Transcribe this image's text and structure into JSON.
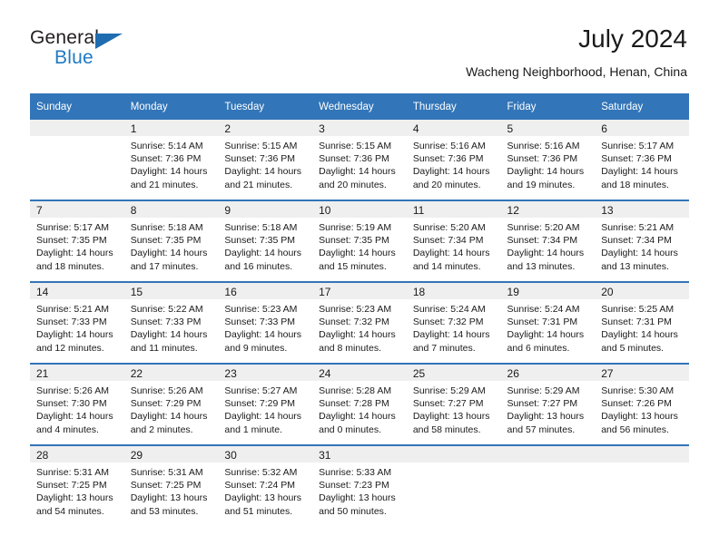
{
  "brand": {
    "name_primary": "General",
    "name_secondary": "Blue",
    "logo_icon": "triangle-logo-icon",
    "color_primary": "#231f20",
    "color_secondary": "#1f7ac4",
    "color_triangle": "#1f6cb0"
  },
  "header": {
    "title": "July 2024",
    "subtitle": "Wacheng Neighborhood, Henan, China"
  },
  "theme": {
    "header_bar_bg": "#3275b8",
    "header_bar_text": "#ffffff",
    "daynum_band_bg": "#efefef",
    "week_divider": "#3275b8",
    "body_text": "#1a1a1a"
  },
  "weekday_headers": [
    "Sunday",
    "Monday",
    "Tuesday",
    "Wednesday",
    "Thursday",
    "Friday",
    "Saturday"
  ],
  "weeks": [
    [
      {
        "day": "",
        "lines": []
      },
      {
        "day": "1",
        "lines": [
          "Sunrise: 5:14 AM",
          "Sunset: 7:36 PM",
          "Daylight: 14 hours",
          "and 21 minutes."
        ]
      },
      {
        "day": "2",
        "lines": [
          "Sunrise: 5:15 AM",
          "Sunset: 7:36 PM",
          "Daylight: 14 hours",
          "and 21 minutes."
        ]
      },
      {
        "day": "3",
        "lines": [
          "Sunrise: 5:15 AM",
          "Sunset: 7:36 PM",
          "Daylight: 14 hours",
          "and 20 minutes."
        ]
      },
      {
        "day": "4",
        "lines": [
          "Sunrise: 5:16 AM",
          "Sunset: 7:36 PM",
          "Daylight: 14 hours",
          "and 20 minutes."
        ]
      },
      {
        "day": "5",
        "lines": [
          "Sunrise: 5:16 AM",
          "Sunset: 7:36 PM",
          "Daylight: 14 hours",
          "and 19 minutes."
        ]
      },
      {
        "day": "6",
        "lines": [
          "Sunrise: 5:17 AM",
          "Sunset: 7:36 PM",
          "Daylight: 14 hours",
          "and 18 minutes."
        ]
      }
    ],
    [
      {
        "day": "7",
        "lines": [
          "Sunrise: 5:17 AM",
          "Sunset: 7:35 PM",
          "Daylight: 14 hours",
          "and 18 minutes."
        ]
      },
      {
        "day": "8",
        "lines": [
          "Sunrise: 5:18 AM",
          "Sunset: 7:35 PM",
          "Daylight: 14 hours",
          "and 17 minutes."
        ]
      },
      {
        "day": "9",
        "lines": [
          "Sunrise: 5:18 AM",
          "Sunset: 7:35 PM",
          "Daylight: 14 hours",
          "and 16 minutes."
        ]
      },
      {
        "day": "10",
        "lines": [
          "Sunrise: 5:19 AM",
          "Sunset: 7:35 PM",
          "Daylight: 14 hours",
          "and 15 minutes."
        ]
      },
      {
        "day": "11",
        "lines": [
          "Sunrise: 5:20 AM",
          "Sunset: 7:34 PM",
          "Daylight: 14 hours",
          "and 14 minutes."
        ]
      },
      {
        "day": "12",
        "lines": [
          "Sunrise: 5:20 AM",
          "Sunset: 7:34 PM",
          "Daylight: 14 hours",
          "and 13 minutes."
        ]
      },
      {
        "day": "13",
        "lines": [
          "Sunrise: 5:21 AM",
          "Sunset: 7:34 PM",
          "Daylight: 14 hours",
          "and 13 minutes."
        ]
      }
    ],
    [
      {
        "day": "14",
        "lines": [
          "Sunrise: 5:21 AM",
          "Sunset: 7:33 PM",
          "Daylight: 14 hours",
          "and 12 minutes."
        ]
      },
      {
        "day": "15",
        "lines": [
          "Sunrise: 5:22 AM",
          "Sunset: 7:33 PM",
          "Daylight: 14 hours",
          "and 11 minutes."
        ]
      },
      {
        "day": "16",
        "lines": [
          "Sunrise: 5:23 AM",
          "Sunset: 7:33 PM",
          "Daylight: 14 hours",
          "and 9 minutes."
        ]
      },
      {
        "day": "17",
        "lines": [
          "Sunrise: 5:23 AM",
          "Sunset: 7:32 PM",
          "Daylight: 14 hours",
          "and 8 minutes."
        ]
      },
      {
        "day": "18",
        "lines": [
          "Sunrise: 5:24 AM",
          "Sunset: 7:32 PM",
          "Daylight: 14 hours",
          "and 7 minutes."
        ]
      },
      {
        "day": "19",
        "lines": [
          "Sunrise: 5:24 AM",
          "Sunset: 7:31 PM",
          "Daylight: 14 hours",
          "and 6 minutes."
        ]
      },
      {
        "day": "20",
        "lines": [
          "Sunrise: 5:25 AM",
          "Sunset: 7:31 PM",
          "Daylight: 14 hours",
          "and 5 minutes."
        ]
      }
    ],
    [
      {
        "day": "21",
        "lines": [
          "Sunrise: 5:26 AM",
          "Sunset: 7:30 PM",
          "Daylight: 14 hours",
          "and 4 minutes."
        ]
      },
      {
        "day": "22",
        "lines": [
          "Sunrise: 5:26 AM",
          "Sunset: 7:29 PM",
          "Daylight: 14 hours",
          "and 2 minutes."
        ]
      },
      {
        "day": "23",
        "lines": [
          "Sunrise: 5:27 AM",
          "Sunset: 7:29 PM",
          "Daylight: 14 hours",
          "and 1 minute."
        ]
      },
      {
        "day": "24",
        "lines": [
          "Sunrise: 5:28 AM",
          "Sunset: 7:28 PM",
          "Daylight: 14 hours",
          "and 0 minutes."
        ]
      },
      {
        "day": "25",
        "lines": [
          "Sunrise: 5:29 AM",
          "Sunset: 7:27 PM",
          "Daylight: 13 hours",
          "and 58 minutes."
        ]
      },
      {
        "day": "26",
        "lines": [
          "Sunrise: 5:29 AM",
          "Sunset: 7:27 PM",
          "Daylight: 13 hours",
          "and 57 minutes."
        ]
      },
      {
        "day": "27",
        "lines": [
          "Sunrise: 5:30 AM",
          "Sunset: 7:26 PM",
          "Daylight: 13 hours",
          "and 56 minutes."
        ]
      }
    ],
    [
      {
        "day": "28",
        "lines": [
          "Sunrise: 5:31 AM",
          "Sunset: 7:25 PM",
          "Daylight: 13 hours",
          "and 54 minutes."
        ]
      },
      {
        "day": "29",
        "lines": [
          "Sunrise: 5:31 AM",
          "Sunset: 7:25 PM",
          "Daylight: 13 hours",
          "and 53 minutes."
        ]
      },
      {
        "day": "30",
        "lines": [
          "Sunrise: 5:32 AM",
          "Sunset: 7:24 PM",
          "Daylight: 13 hours",
          "and 51 minutes."
        ]
      },
      {
        "day": "31",
        "lines": [
          "Sunrise: 5:33 AM",
          "Sunset: 7:23 PM",
          "Daylight: 13 hours",
          "and 50 minutes."
        ]
      },
      {
        "day": "",
        "lines": []
      },
      {
        "day": "",
        "lines": []
      },
      {
        "day": "",
        "lines": []
      }
    ]
  ]
}
